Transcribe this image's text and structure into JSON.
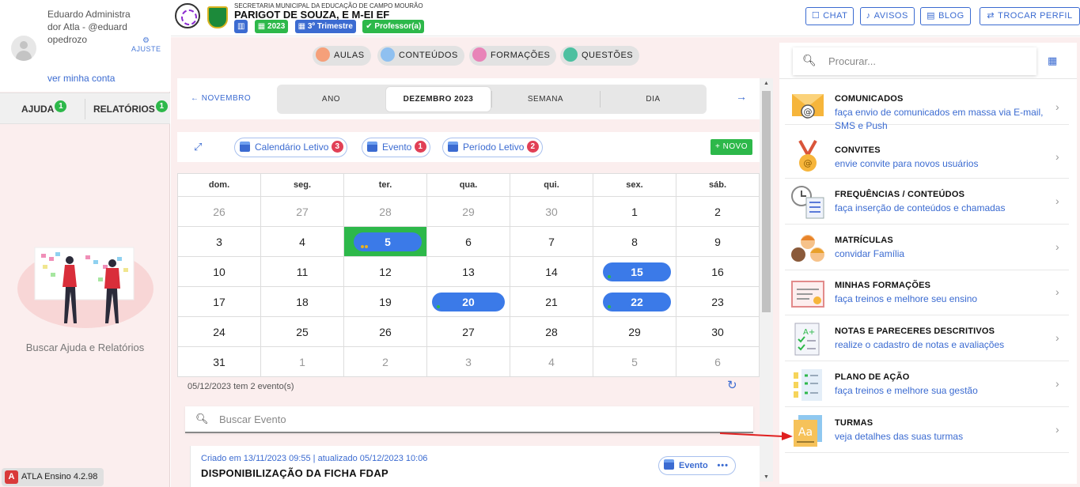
{
  "user": {
    "name": "Eduardo Administrador Atla - @eduardopedrozo",
    "settings_label": "AJUSTE",
    "my_account_link": "ver minha conta"
  },
  "sidebar": {
    "tabs": [
      {
        "label": "AJUDA",
        "badge": "1"
      },
      {
        "label": "RELATÓRIOS",
        "badge": "1"
      }
    ],
    "help_text": "Buscar Ajuda e Relatórios",
    "version": "ATLA Ensino 4.2.98"
  },
  "header": {
    "org": "SECRETARIA MUNICIPAL DA EDUCAÇÃO DE CAMPO MOURÃO",
    "school": "PARIGOT DE SOUZA, E M-EI EF",
    "chips": [
      "2023",
      "3º Trimestre",
      "Professor(a)"
    ],
    "actions": [
      "CHAT",
      "AVISOS",
      "BLOG",
      "TROCAR PERFIL"
    ]
  },
  "nav": [
    "AULAS",
    "CONTEÚDOS",
    "FORMAÇÕES",
    "QUESTÕES"
  ],
  "calendar": {
    "prev_label": "NOVEMBRO",
    "views": [
      "ANO",
      "DEZEMBRO 2023",
      "SEMANA",
      "DIA"
    ],
    "active_view": "DEZEMBRO 2023",
    "filters": [
      {
        "label": "Calendário Letivo",
        "count": "3"
      },
      {
        "label": "Evento",
        "count": "1"
      },
      {
        "label": "Período Letivo",
        "count": "2"
      }
    ],
    "new_label": "NOVO",
    "weekdays": [
      "dom.",
      "seg.",
      "ter.",
      "qua.",
      "qui.",
      "sex.",
      "sáb."
    ],
    "weeks": [
      [
        "26",
        "27",
        "28",
        "29",
        "30",
        "1",
        "2"
      ],
      [
        "3",
        "4",
        "5",
        "6",
        "7",
        "8",
        "9"
      ],
      [
        "10",
        "11",
        "12",
        "13",
        "14",
        "15",
        "16"
      ],
      [
        "17",
        "18",
        "19",
        "20",
        "21",
        "22",
        "23"
      ],
      [
        "24",
        "25",
        "26",
        "27",
        "28",
        "29",
        "30"
      ],
      [
        "31",
        "1",
        "2",
        "3",
        "4",
        "5",
        "6"
      ]
    ],
    "event_count_text": "05/12/2023 tem 2 evento(s)",
    "search_placeholder": "Buscar Evento"
  },
  "event": {
    "meta": "Criado em 13/11/2023 09:55 | atualizado 05/12/2023 10:06",
    "title": "DISPONIBILIZAÇÃO DA FICHA FDAP",
    "tag": "Evento"
  },
  "right": {
    "search_placeholder": "Procurar...",
    "items": [
      {
        "title": "COMUNICADOS",
        "desc": "faça envio de comunicados em massa via E-mail, SMS e Push",
        "icon": "envelope-icon"
      },
      {
        "title": "CONVITES",
        "desc": "envie convite para novos usuários",
        "icon": "medal-icon"
      },
      {
        "title": "FREQUÊNCIAS / CONTEÚDOS",
        "desc": "faça inserção de conteúdos e chamadas",
        "icon": "clock-checklist-icon"
      },
      {
        "title": "MATRÍCULAS",
        "desc": "convidar Família",
        "icon": "children-icon"
      },
      {
        "title": "MINHAS FORMAÇÕES",
        "desc": "faça treinos e melhore seu ensino",
        "icon": "certificate-icon"
      },
      {
        "title": "NOTAS E PARECERES DESCRITIVOS",
        "desc": "realize o cadastro de notas e avaliações",
        "icon": "grade-sheet-icon"
      },
      {
        "title": "PLANO DE AÇÃO",
        "desc": "faça treinos e melhore sua gestão",
        "icon": "action-plan-icon"
      },
      {
        "title": "TURMAS",
        "desc": "veja detalhes das suas turmas",
        "icon": "class-book-icon"
      }
    ]
  },
  "colors": {
    "accent": "#3b6bd1",
    "success": "#2db84a",
    "danger": "#e14056",
    "background": "#fbeeee"
  }
}
